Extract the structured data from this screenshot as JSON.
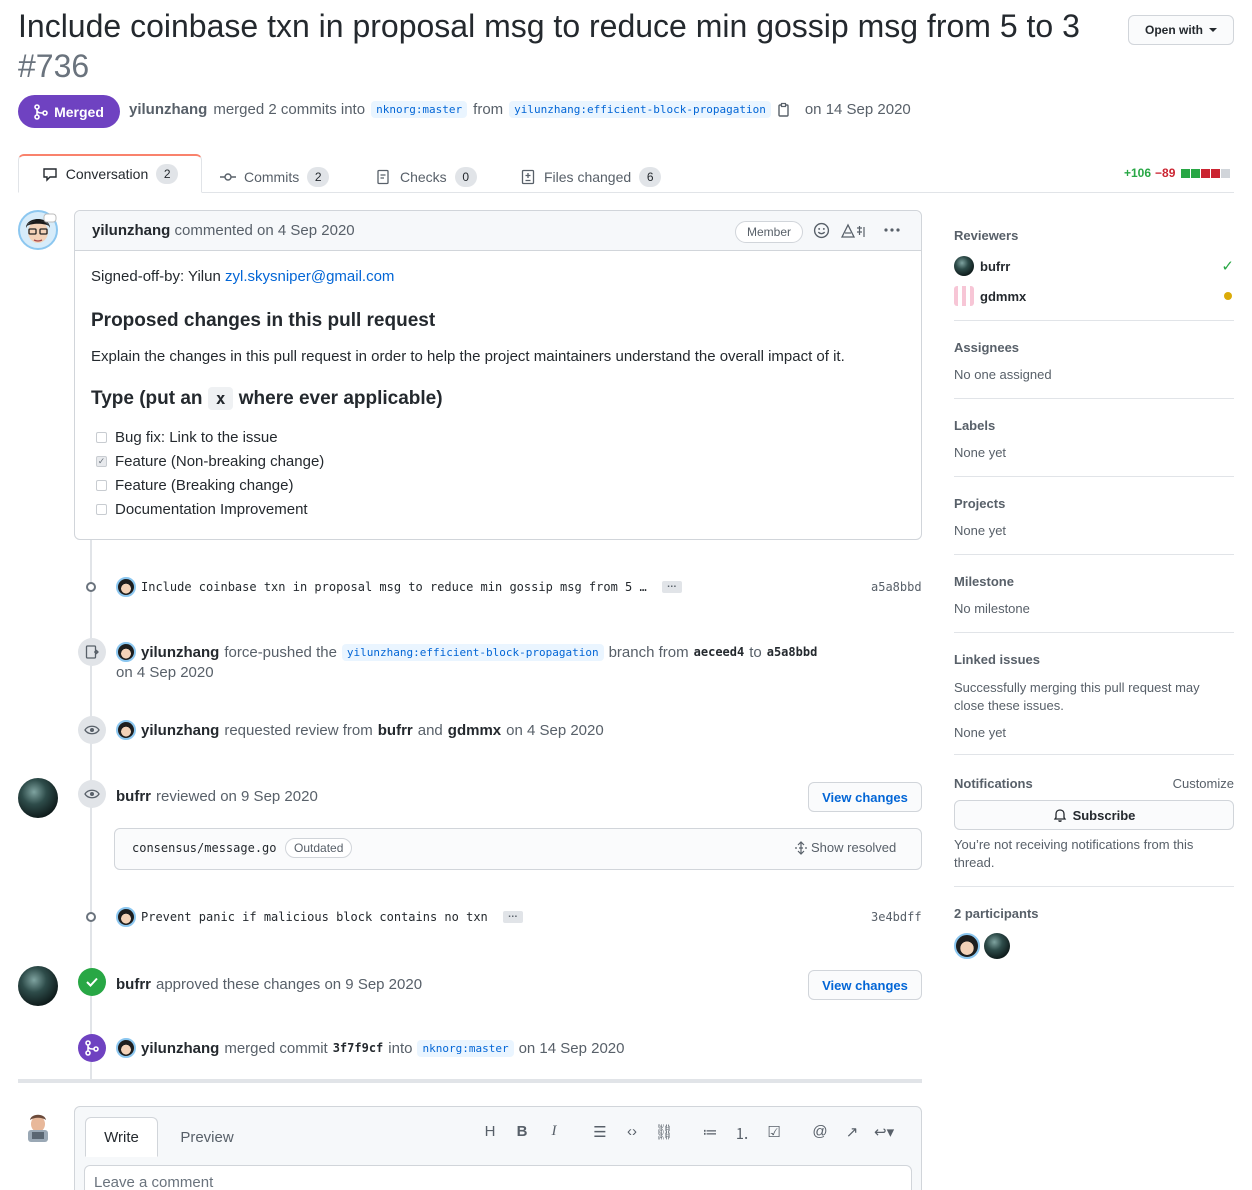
{
  "header": {
    "title": "Include coinbase txn in proposal msg to reduce min gossip msg from 5 to 3",
    "number": "#736",
    "open_with": "Open with",
    "status": "Merged",
    "author": "yilunzhang",
    "merged_text": "merged 2 commits into",
    "base_branch": "nknorg:master",
    "from_text": "from",
    "head_branch": "yilunzhang:efficient-block-propagation",
    "date_text": "on 14 Sep 2020"
  },
  "tabs": [
    {
      "label": "Conversation",
      "count": "2"
    },
    {
      "label": "Commits",
      "count": "2"
    },
    {
      "label": "Checks",
      "count": "0"
    },
    {
      "label": "Files changed",
      "count": "6"
    }
  ],
  "diffstat": {
    "additions": "+106",
    "deletions": "−89"
  },
  "comment": {
    "author": "yilunzhang",
    "meta": "commented on 4 Sep 2020",
    "role": "Member",
    "signed_off": "Signed-off-by: Yilun",
    "email": "zyl.skysniper@gmail.com",
    "heading1": "Proposed changes in this pull request",
    "para": "Explain the changes in this pull request in order to help the project maintainers understand the overall impact of it.",
    "heading2_pre": "Type (put an",
    "heading2_code": "x",
    "heading2_post": "where ever applicable)",
    "tasks": [
      {
        "label": "Bug fix: Link to the issue",
        "checked": false
      },
      {
        "label": "Feature (Non-breaking change)",
        "checked": true
      },
      {
        "label": "Feature (Breaking change)",
        "checked": false
      },
      {
        "label": "Documentation Improvement",
        "checked": false
      }
    ]
  },
  "timeline": {
    "commit1": {
      "message": "Include coinbase txn in proposal msg to reduce min gossip msg from 5 …",
      "sha": "a5a8bbd"
    },
    "force_push": {
      "user": "yilunzhang",
      "text1": "force-pushed the",
      "branch": "yilunzhang:efficient-block-propagation",
      "text2": "branch from",
      "from_sha": "aeceed4",
      "to": "to",
      "to_sha": "a5a8bbd",
      "date": "on 4 Sep 2020"
    },
    "review_request": {
      "user": "yilunzhang",
      "text1": "requested review from",
      "r1": "bufrr",
      "and": "and",
      "r2": "gdmmx",
      "date": "on 4 Sep 2020"
    },
    "reviewed": {
      "user": "bufrr",
      "text": "reviewed on 9 Sep 2020",
      "button": "View changes",
      "file": "consensus/message.go",
      "outdated": "Outdated",
      "show_resolved": "Show resolved"
    },
    "commit2": {
      "message": "Prevent panic if malicious block contains no txn",
      "sha": "3e4bdff"
    },
    "approved": {
      "user": "bufrr",
      "text": "approved these changes on 9 Sep 2020",
      "button": "View changes"
    },
    "merged": {
      "user": "yilunzhang",
      "text1": "merged commit",
      "sha": "3f7f9cf",
      "text2": "into",
      "branch": "nknorg:master",
      "date": "on 14 Sep 2020"
    }
  },
  "editor": {
    "write": "Write",
    "preview": "Preview",
    "placeholder": "Leave a comment"
  },
  "sidebar": {
    "reviewers_title": "Reviewers",
    "reviewers": [
      {
        "name": "bufrr",
        "state": "approved"
      },
      {
        "name": "gdmmx",
        "state": "pending"
      }
    ],
    "assignees_title": "Assignees",
    "assignees_value": "No one assigned",
    "labels_title": "Labels",
    "labels_value": "None yet",
    "projects_title": "Projects",
    "projects_value": "None yet",
    "milestone_title": "Milestone",
    "milestone_value": "No milestone",
    "linked_title": "Linked issues",
    "linked_desc": "Successfully merging this pull request may close these issues.",
    "linked_value": "None yet",
    "notifications_title": "Notifications",
    "customize": "Customize",
    "subscribe": "Subscribe",
    "notif_desc": "You’re not receiving notifications from this thread.",
    "participants_title": "2 participants"
  },
  "colors": {
    "merged": "#6f42c1",
    "approved": "#28a745",
    "link": "#0366d6",
    "tab_accent": "#f9826c",
    "deletions": "#cb2431"
  }
}
